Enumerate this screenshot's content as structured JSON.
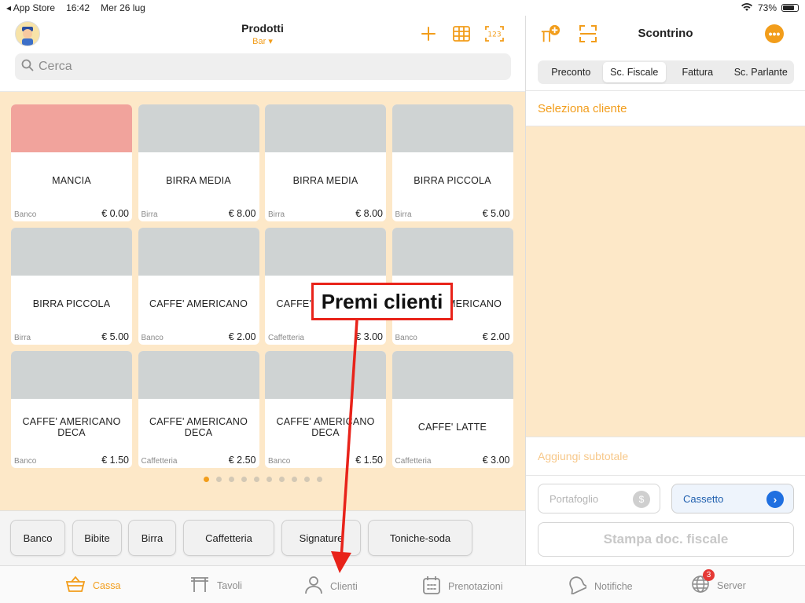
{
  "status_bar": {
    "back_app": "◂ App Store",
    "time": "16:42",
    "date": "Mer 26 lug",
    "battery": "73%"
  },
  "header": {
    "title": "Prodotti",
    "subtitle": "Bar ▾"
  },
  "search": {
    "placeholder": "Cerca"
  },
  "products": [
    {
      "name": "MANCIA",
      "category": "Banco",
      "price": "€ 0.00",
      "highlight": true
    },
    {
      "name": "BIRRA MEDIA",
      "category": "Birra",
      "price": "€ 8.00"
    },
    {
      "name": "BIRRA MEDIA",
      "category": "Birra",
      "price": "€ 8.00"
    },
    {
      "name": "BIRRA PICCOLA",
      "category": "Birra",
      "price": "€ 5.00"
    },
    {
      "name": "BIRRA PICCOLA",
      "category": "Birra",
      "price": "€ 5.00"
    },
    {
      "name": "CAFFE' AMERICANO",
      "category": "Banco",
      "price": "€ 2.00"
    },
    {
      "name": "CAFFE' AMERICANO",
      "category": "Caffetteria",
      "price": "€ 3.00"
    },
    {
      "name": "CAFFE' AMERICANO",
      "category": "Banco",
      "price": "€ 2.00"
    },
    {
      "name": "CAFFE' AMERICANO DECA",
      "category": "Banco",
      "price": "€ 1.50"
    },
    {
      "name": "CAFFE' AMERICANO DECA",
      "category": "Caffetteria",
      "price": "€ 2.50"
    },
    {
      "name": "CAFFE' AMERICANO DECA",
      "category": "Banco",
      "price": "€ 1.50"
    },
    {
      "name": "CAFFE' LATTE",
      "category": "Caffetteria",
      "price": "€ 3.00"
    }
  ],
  "pagination": {
    "pages": 10,
    "current": 1
  },
  "categories": [
    "Banco",
    "Bibite",
    "Birra",
    "Caffetteria",
    "Signature",
    "Toniche-soda"
  ],
  "receipt": {
    "title": "Scontrino",
    "segments": [
      "Preconto",
      "Sc. Fiscale",
      "Fattura",
      "Sc. Parlante"
    ],
    "selected_segment": "Sc. Fiscale",
    "select_customer": "Seleziona cliente",
    "add_subtotal": "Aggiungi subtotale",
    "wallet_label": "Portafoglio",
    "drawer_label": "Cassetto",
    "print_label": "Stampa doc. fiscale"
  },
  "tabs": [
    {
      "label": "Cassa",
      "icon": "basket-icon",
      "active": true
    },
    {
      "label": "Tavoli",
      "icon": "table-icon"
    },
    {
      "label": "Clienti",
      "icon": "person-icon"
    },
    {
      "label": "Prenotazioni",
      "icon": "calendar-icon"
    },
    {
      "label": "Notifiche",
      "icon": "bell-icon"
    },
    {
      "label": "Server",
      "icon": "globe-icon",
      "badge": "3"
    }
  ],
  "annotation": {
    "text": "Premi clienti",
    "color": "#e8231a"
  },
  "colors": {
    "accent": "#f29d1b",
    "panel_bg": "#fde8c8",
    "card_top": "#cfd3d3",
    "highlight_top": "#f1a39c"
  }
}
